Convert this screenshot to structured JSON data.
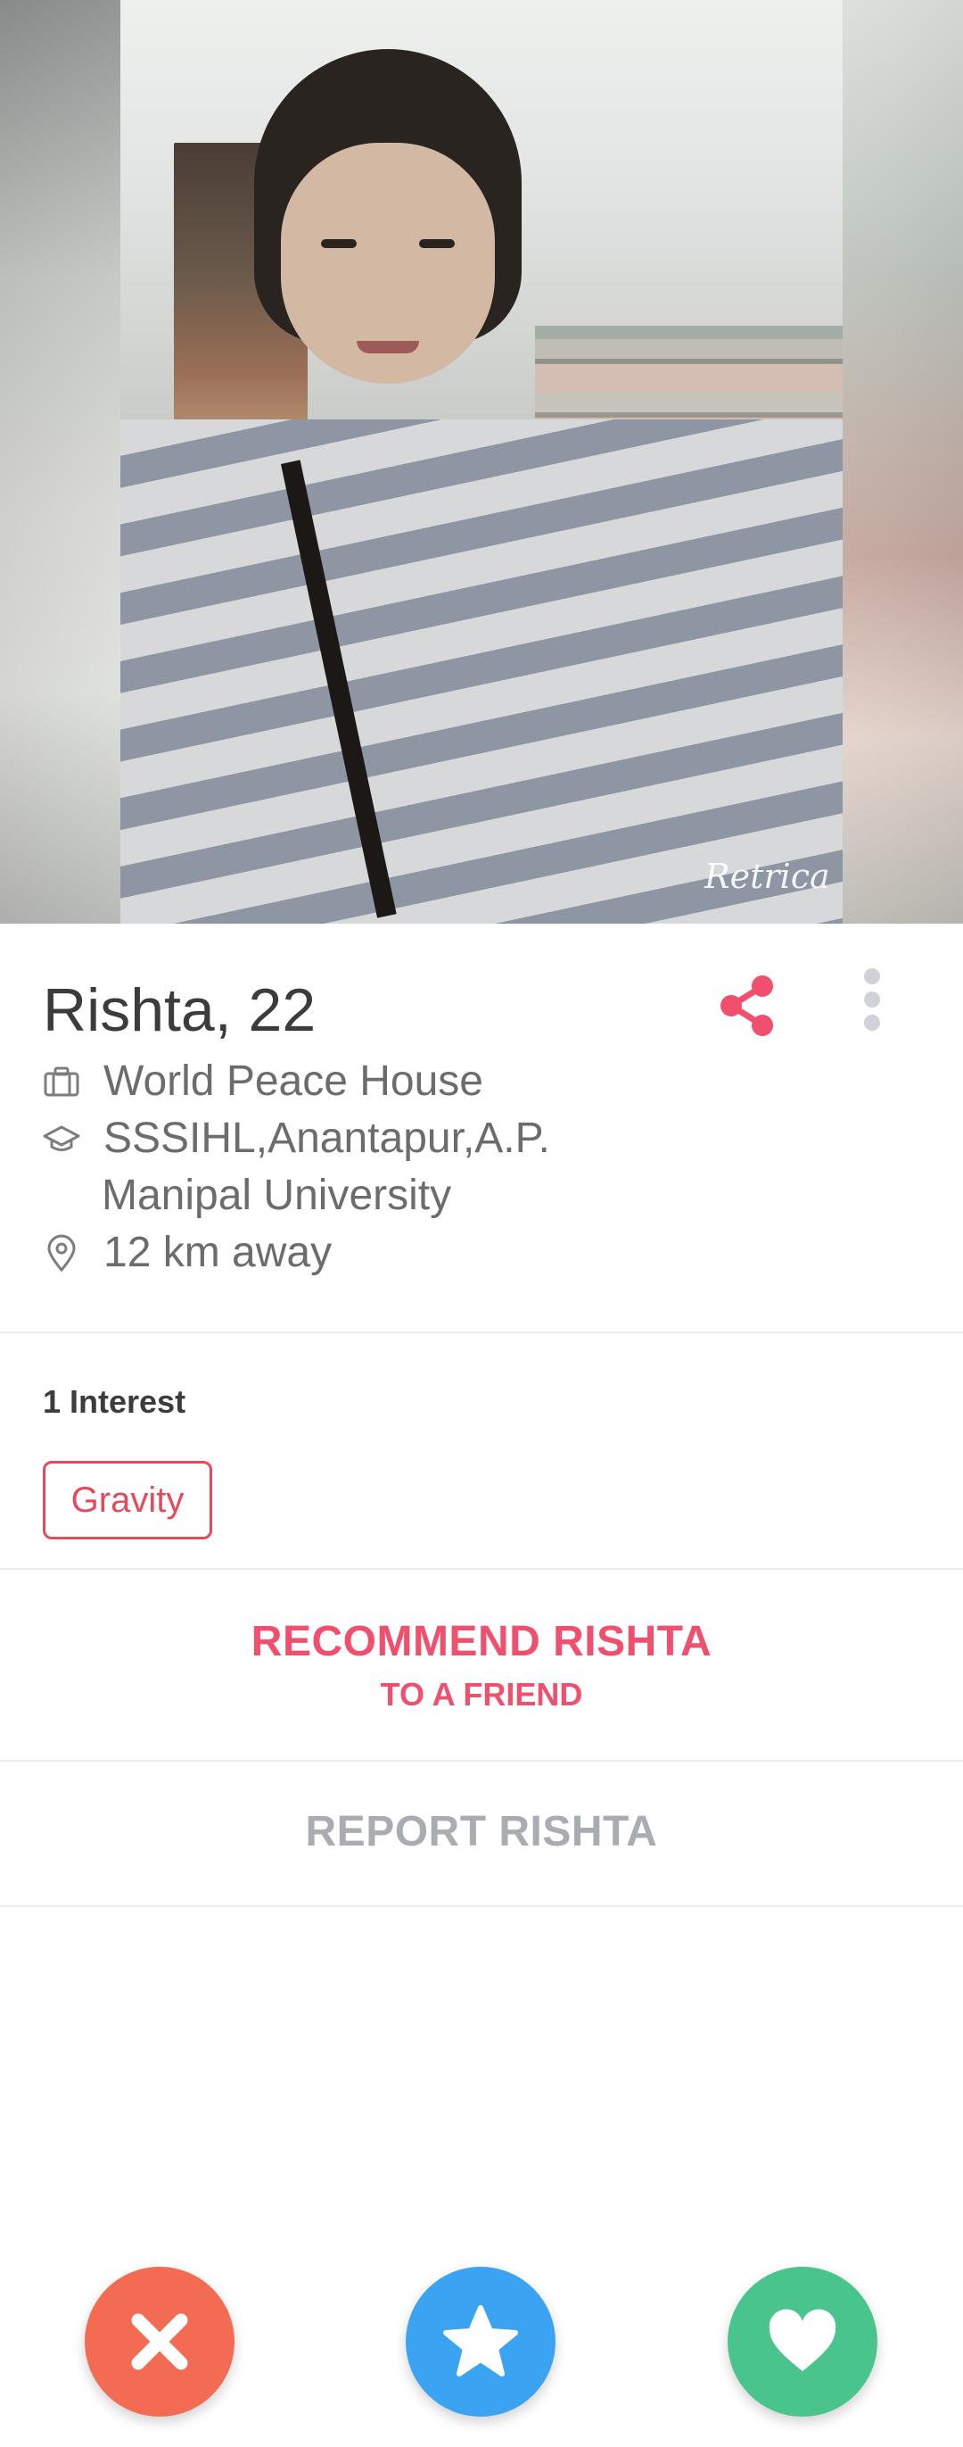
{
  "profile": {
    "name_age": "Rishta, 22",
    "job": "World Peace House",
    "school_1": "SSSIHL,Anantapur,A.P.",
    "school_2": "Manipal University",
    "distance": "12 km away",
    "photo_watermark": "Retrica"
  },
  "interests": {
    "title": "1 Interest",
    "items": [
      "Gravity"
    ]
  },
  "recommend": {
    "line1": "RECOMMEND RISHTA",
    "line2": "TO A FRIEND"
  },
  "report": {
    "label": "REPORT RISHTA"
  },
  "icons": {
    "share": "share-icon",
    "more": "more-vertical-icon",
    "job": "briefcase-icon",
    "school": "graduation-cap-icon",
    "distance": "location-pin-icon",
    "nope": "close-icon",
    "super_like": "star-icon",
    "like": "heart-icon"
  },
  "colors": {
    "accent": "#f0506e",
    "chip": "#e44a5c",
    "nope": "#f36b52",
    "super_like": "#3aa3f2",
    "like": "#48c48c",
    "muted": "#a8adb2"
  }
}
